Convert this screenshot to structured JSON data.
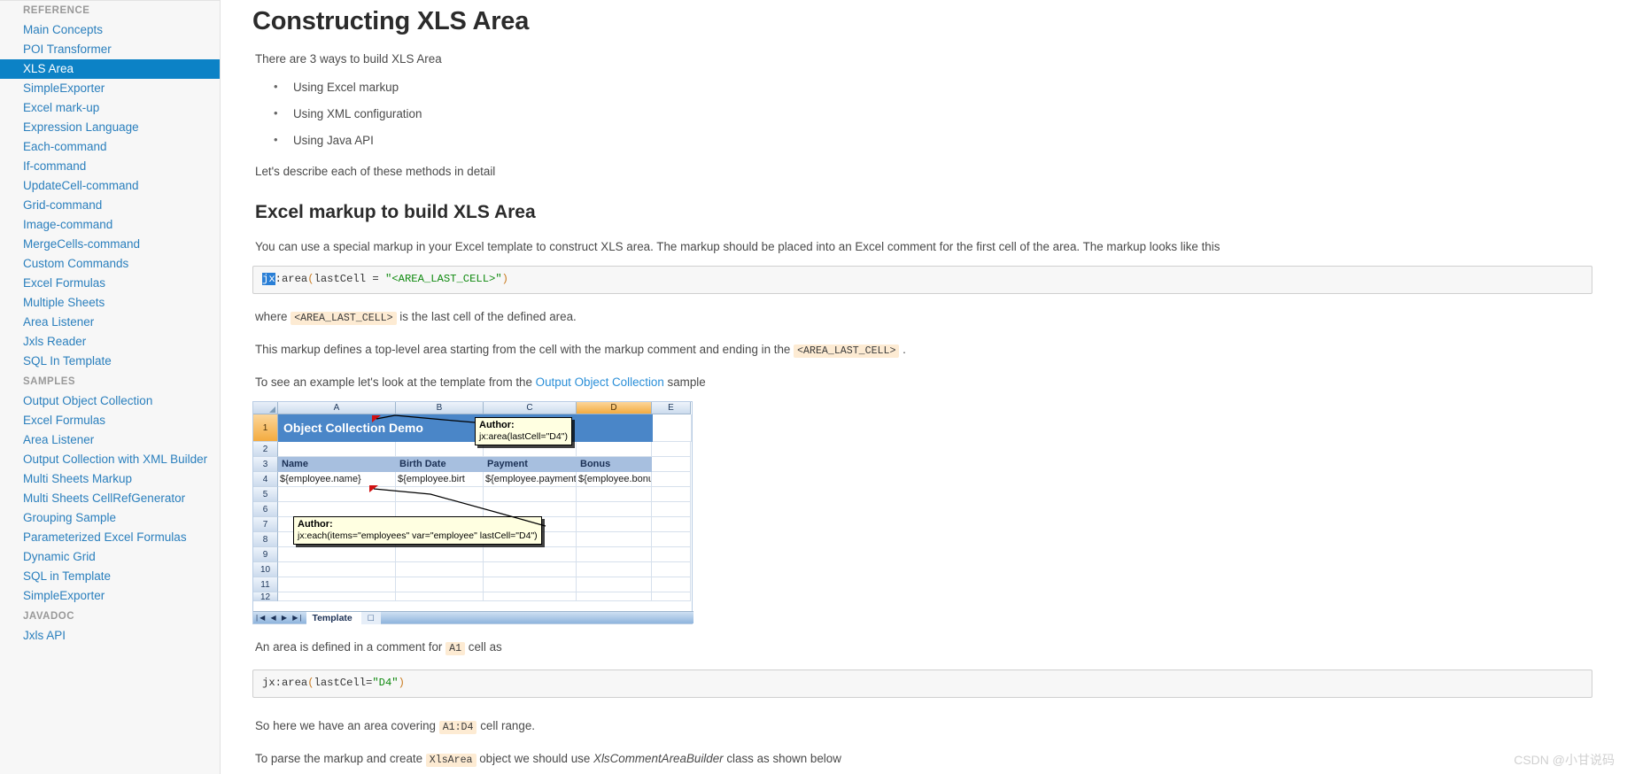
{
  "sidebar": {
    "sections": [
      {
        "label": "REFERENCE",
        "items": [
          {
            "label": "Main Concepts",
            "active": false
          },
          {
            "label": "POI Transformer",
            "active": false
          },
          {
            "label": "XLS Area",
            "active": true
          },
          {
            "label": "SimpleExporter",
            "active": false
          },
          {
            "label": "Excel mark-up",
            "active": false
          },
          {
            "label": "Expression Language",
            "active": false
          },
          {
            "label": "Each-command",
            "active": false
          },
          {
            "label": "If-command",
            "active": false
          },
          {
            "label": "UpdateCell-command",
            "active": false
          },
          {
            "label": "Grid-command",
            "active": false
          },
          {
            "label": "Image-command",
            "active": false
          },
          {
            "label": "MergeCells-command",
            "active": false
          },
          {
            "label": "Custom Commands",
            "active": false
          },
          {
            "label": "Excel Formulas",
            "active": false
          },
          {
            "label": "Multiple Sheets",
            "active": false
          },
          {
            "label": "Area Listener",
            "active": false
          },
          {
            "label": "Jxls Reader",
            "active": false
          },
          {
            "label": "SQL In Template",
            "active": false
          }
        ]
      },
      {
        "label": "SAMPLES",
        "items": [
          {
            "label": "Output Object Collection",
            "active": false
          },
          {
            "label": "Excel Formulas",
            "active": false
          },
          {
            "label": "Area Listener",
            "active": false
          },
          {
            "label": "Output Collection with XML Builder",
            "active": false
          },
          {
            "label": "Multi Sheets Markup",
            "active": false
          },
          {
            "label": "Multi Sheets CellRefGenerator",
            "active": false
          },
          {
            "label": "Grouping Sample",
            "active": false
          },
          {
            "label": "Parameterized Excel Formulas",
            "active": false
          },
          {
            "label": "Dynamic Grid",
            "active": false
          },
          {
            "label": "SQL in Template",
            "active": false
          },
          {
            "label": "SimpleExporter",
            "active": false
          }
        ]
      },
      {
        "label": "JAVADOC",
        "items": [
          {
            "label": "Jxls API",
            "active": false
          }
        ]
      }
    ]
  },
  "main": {
    "page_title": "Constructing XLS Area",
    "intro": "There are 3 ways to build XLS Area",
    "ways": [
      "Using Excel markup",
      "Using XML configuration",
      "Using Java API"
    ],
    "after_list": "Let's describe each of these methods in detail",
    "section_title": "Excel markup to build XLS Area",
    "markup_para": "You can use a special markup in your Excel template to construct XLS area. The markup should be placed into an Excel comment for the first cell of the area. The markup looks like this",
    "code1": {
      "selected": "jx",
      "rest_open": ":area",
      "paren_open": "(",
      "arg": "lastCell",
      "eq": " = ",
      "string": "\"<AREA_LAST_CELL>\"",
      "paren_close": ")"
    },
    "where_prefix": "where ",
    "where_code": "<AREA_LAST_CELL>",
    "where_suffix": " is the last cell of the defined area.",
    "toplevel_prefix": "This markup defines a top-level area starting from the cell with the markup comment and ending in the ",
    "toplevel_code": "<AREA_LAST_CELL>",
    "toplevel_suffix": " .",
    "example_prefix": "To see an example let's look at the template from the ",
    "example_link": "Output Object Collection",
    "example_suffix": " sample",
    "after_excel_prefix": "An area is defined in a comment for ",
    "after_excel_code": "A1",
    "after_excel_suffix": " cell as",
    "code2": {
      "name": "jx:area",
      "paren_open": "(",
      "arg": "lastCell=",
      "string": "\"D4\"",
      "paren_close": ")"
    },
    "covering_prefix": "So here we have an area covering ",
    "covering_code": "A1:D4",
    "covering_suffix": " cell range.",
    "parse_prefix": "To parse the markup and create ",
    "parse_code": "XlsArea",
    "parse_mid": " object we should use ",
    "parse_italic": "XlsCommentAreaBuilder",
    "parse_suffix": " class as shown below"
  },
  "excel": {
    "columns": [
      "A",
      "B",
      "C",
      "D",
      "E"
    ],
    "selected_column": "D",
    "rows": [
      "1",
      "2",
      "3",
      "4",
      "5",
      "6",
      "7",
      "8",
      "9",
      "10",
      "11",
      "12"
    ],
    "selected_row": "1",
    "title_cell": "Object Collection Demo",
    "header_row": [
      "Name",
      "Birth Date",
      "Payment",
      "Bonus"
    ],
    "data_row": [
      "${employee.name}",
      "${employee.birt",
      "${employee.payment}",
      "${employee.bonus}"
    ],
    "comment1": {
      "author": "Author:",
      "text": "jx:area(lastCell=\"D4\")"
    },
    "comment2": {
      "author": "Author:",
      "text": "jx:each(items=\"employees\" var=\"employee\" lastCell=\"D4\")"
    },
    "tab_label": "Template",
    "nav_buttons": "|◀ ◀ ▶ ▶|",
    "new_sheet_icon": "new-sheet-icon"
  },
  "watermark": "CSDN @小甘说码",
  "colors": {
    "accent": "#0c82c6",
    "link": "#2a7fbd",
    "inline_code_bg": "#fdebd3",
    "excel_title_bg": "#4a86c8",
    "excel_header_bg": "#a7bfdf",
    "comment_bg": "#ffffe1",
    "selected_col_bg": "#f3ab3f"
  }
}
